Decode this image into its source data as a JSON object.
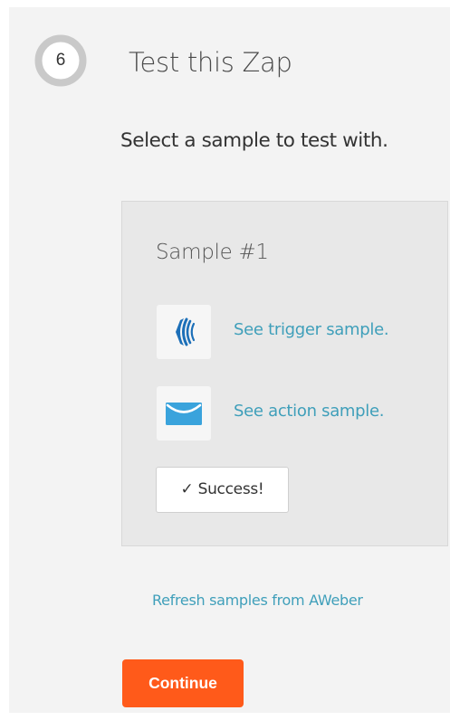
{
  "step": {
    "number": "6",
    "title": "Test this Zap",
    "progress": 0.0
  },
  "instructions": "Select a sample to test with.",
  "sample": {
    "title": "Sample #1",
    "trigger": {
      "app_icon": "aweber-icon",
      "link_label": "See trigger sample."
    },
    "action": {
      "app_icon": "email-envelope-icon",
      "link_label": "See action sample."
    },
    "status_button_label": "✓ Success!"
  },
  "refresh_link_label": "Refresh samples from AWeber",
  "continue_label": "Continue",
  "colors": {
    "link": "#3f9fba",
    "continue_button": "#ff5a1a",
    "aweber_blue": "#1c6fb8",
    "email_blue": "#3aa3dc"
  }
}
